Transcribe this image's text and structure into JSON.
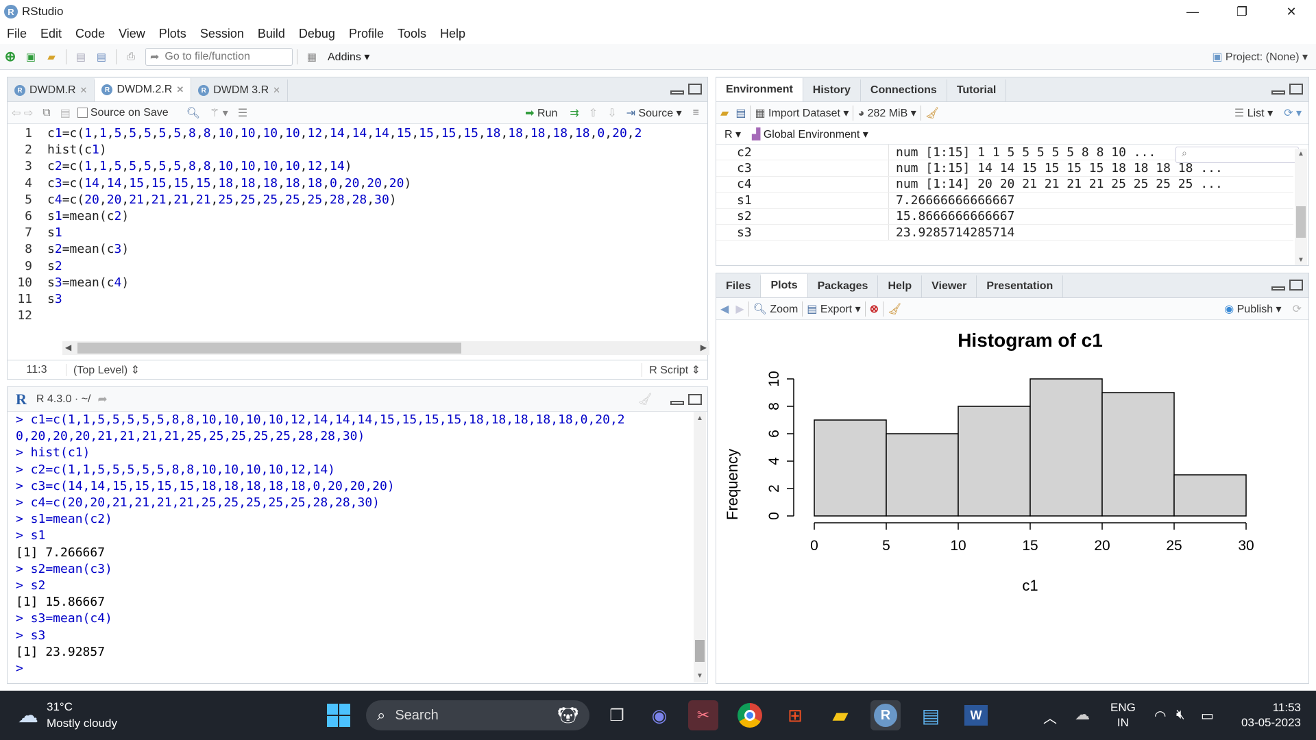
{
  "app": {
    "title": "RStudio",
    "logo_letter": "R"
  },
  "window_controls": {
    "minimize": "—",
    "restore": "❐",
    "close": "✕"
  },
  "menu": [
    "File",
    "Edit",
    "Code",
    "View",
    "Plots",
    "Session",
    "Build",
    "Debug",
    "Profile",
    "Tools",
    "Help"
  ],
  "main_toolbar": {
    "goto_placeholder": "Go to file/function",
    "addins": "Addins",
    "project": "Project: (None)"
  },
  "editor": {
    "tabs": [
      {
        "label": "DWDM.R"
      },
      {
        "label": "DWDM.2.R"
      },
      {
        "label": "DWDM 3.R"
      }
    ],
    "toolbar": {
      "source_on_save": "Source on Save",
      "run": "Run",
      "source": "Source"
    },
    "lines": [
      "c1=c(1,1,5,5,5,5,5,8,8,10,10,10,10,12,14,14,14,15,15,15,15,18,18,18,18,18,0,20,2",
      "hist(c1)",
      "c2=c(1,1,5,5,5,5,5,8,8,10,10,10,10,12,14)",
      "c3=c(14,14,15,15,15,15,18,18,18,18,18,0,20,20,20)",
      "c4=c(20,20,21,21,21,21,25,25,25,25,25,28,28,30)",
      "s1=mean(c2)",
      "s1",
      "s2=mean(c3)",
      "s2",
      "s3=mean(c4)",
      "s3",
      ""
    ],
    "status": {
      "position": "11:3",
      "scope": "(Top Level)",
      "filetype": "R Script"
    }
  },
  "console": {
    "header": "R 4.3.0 · ~/",
    "lines": [
      {
        "t": "> c1=c(1,1,5,5,5,5,5,8,8,10,10,10,10,12,14,14,14,15,15,15,15,18,18,18,18,18,0,20,2",
        "c": "p"
      },
      {
        "t": "0,20,20,20,21,21,21,21,25,25,25,25,25,28,28,30)",
        "c": "p"
      },
      {
        "t": "> hist(c1)",
        "c": "p"
      },
      {
        "t": "> c2=c(1,1,5,5,5,5,5,8,8,10,10,10,10,12,14)",
        "c": "p"
      },
      {
        "t": "> c3=c(14,14,15,15,15,15,18,18,18,18,18,0,20,20,20)",
        "c": "p"
      },
      {
        "t": "> c4=c(20,20,21,21,21,21,25,25,25,25,25,28,28,30)",
        "c": "p"
      },
      {
        "t": "> s1=mean(c2)",
        "c": "p"
      },
      {
        "t": "> s1",
        "c": "p"
      },
      {
        "t": "[1] 7.266667",
        "c": "o"
      },
      {
        "t": "> s2=mean(c3)",
        "c": "p"
      },
      {
        "t": "> s2",
        "c": "p"
      },
      {
        "t": "[1] 15.86667",
        "c": "o"
      },
      {
        "t": "> s3=mean(c4)",
        "c": "p"
      },
      {
        "t": "> s3",
        "c": "p"
      },
      {
        "t": "[1] 23.92857",
        "c": "o"
      },
      {
        "t": "> ",
        "c": "p"
      }
    ]
  },
  "env": {
    "tabs": [
      "Environment",
      "History",
      "Connections",
      "Tutorial"
    ],
    "toolbar": {
      "import": "Import Dataset",
      "memory": "282 MiB",
      "view": "List"
    },
    "scope": {
      "lang": "R",
      "env": "Global Environment"
    },
    "rows": [
      {
        "name": "c2",
        "value": "num [1:15] 1 1 5 5 5 5 5 8 8 10 ..."
      },
      {
        "name": "c3",
        "value": "num [1:15] 14 14 15 15 15 15 18 18 18 18 ..."
      },
      {
        "name": "c4",
        "value": "num [1:14] 20 20 21 21 21 21 25 25 25 25 ..."
      },
      {
        "name": "s1",
        "value": "7.26666666666667"
      },
      {
        "name": "s2",
        "value": "15.8666666666667"
      },
      {
        "name": "s3",
        "value": "23.9285714285714"
      }
    ]
  },
  "files": {
    "tabs": [
      "Files",
      "Plots",
      "Packages",
      "Help",
      "Viewer",
      "Presentation"
    ],
    "toolbar": {
      "zoom": "Zoom",
      "export": "Export",
      "publish": "Publish"
    }
  },
  "chart_data": {
    "type": "bar",
    "title": "Histogram of c1",
    "xlabel": "c1",
    "ylabel": "Frequency",
    "bins": [
      [
        0,
        5
      ],
      [
        5,
        10
      ],
      [
        10,
        15
      ],
      [
        15,
        20
      ],
      [
        20,
        25
      ],
      [
        25,
        30
      ]
    ],
    "values": [
      7,
      6,
      8,
      10,
      9,
      3
    ],
    "xticks": [
      0,
      5,
      10,
      15,
      20,
      25,
      30
    ],
    "yticks": [
      0,
      2,
      4,
      6,
      8,
      10
    ],
    "xlim": [
      0,
      30
    ],
    "ylim": [
      0,
      10
    ],
    "bar_color": "#d3d3d3"
  },
  "taskbar": {
    "temp": "31°C",
    "weather": "Mostly cloudy",
    "search": "Search",
    "lang1": "ENG",
    "lang2": "IN",
    "time": "11:53",
    "date": "03-05-2023"
  }
}
